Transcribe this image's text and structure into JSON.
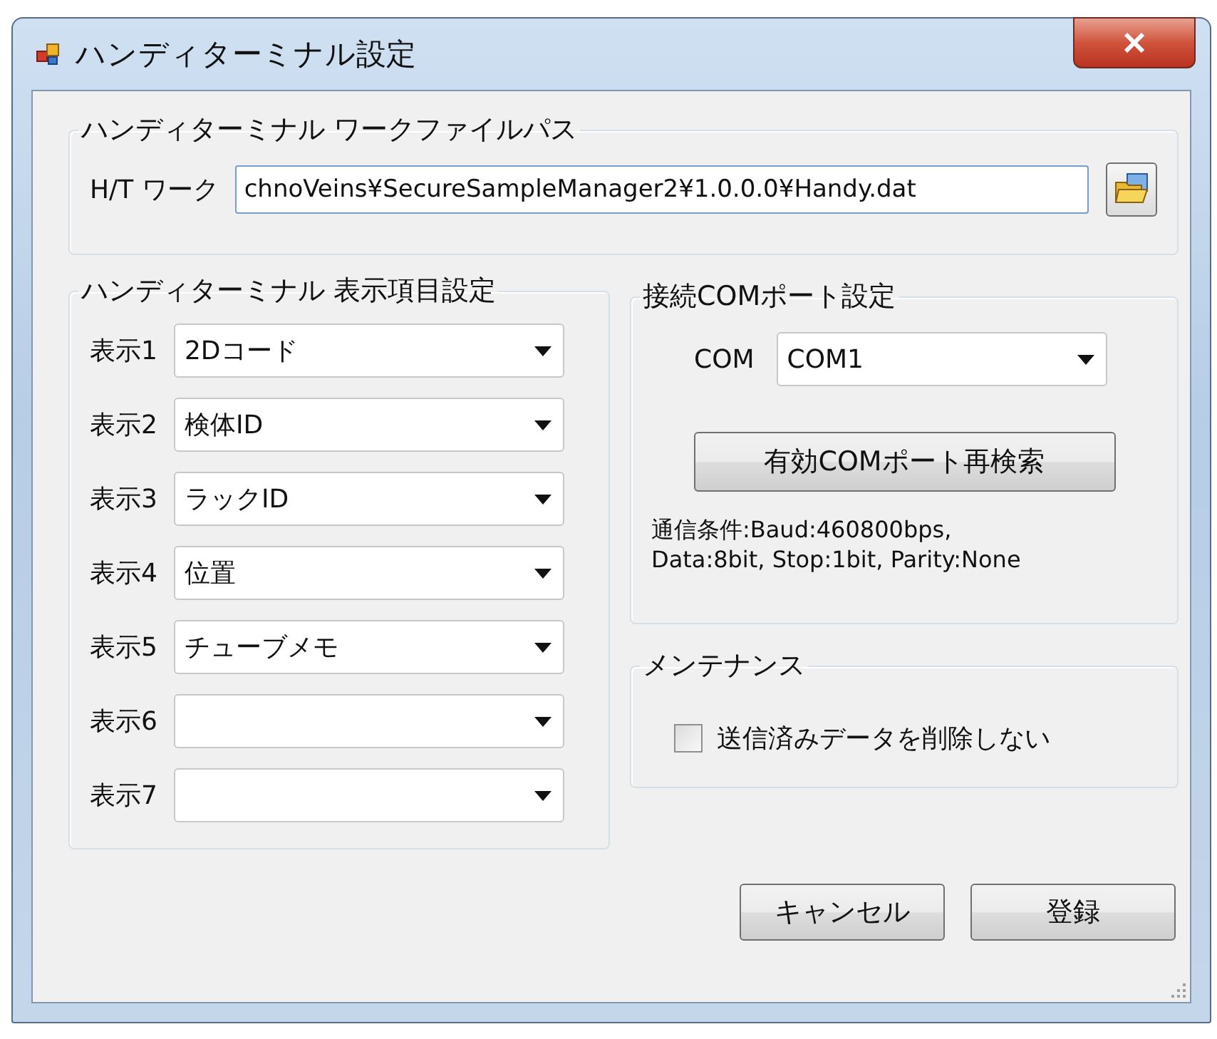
{
  "window": {
    "title": "ハンディターミナル設定"
  },
  "work_file_group": {
    "title": "ハンディターミナル  ワークファイルパス",
    "label": "H/T ワーク",
    "value": "chnoVeins¥SecureSampleManager2¥1.0.0.0¥Handy.dat"
  },
  "display_group": {
    "title": "ハンディターミナル 表示項目設定",
    "items": [
      {
        "label": "表示1",
        "value": "2Dコード"
      },
      {
        "label": "表示2",
        "value": "検体ID"
      },
      {
        "label": "表示3",
        "value": "ラックID"
      },
      {
        "label": "表示4",
        "value": "位置"
      },
      {
        "label": "表示5",
        "value": "チューブメモ"
      },
      {
        "label": "表示6"
      },
      {
        "label": "表示7"
      }
    ]
  },
  "com_group": {
    "title": "接続COMポート設定",
    "label": "COM",
    "value": "COM1",
    "rescan_button": "有効COMポート再検索",
    "conditions": [
      "通信条件:Baud:460800bps,",
      "Data:8bit, Stop:1bit, Parity:None"
    ]
  },
  "maintenance_group": {
    "title": "メンテナンス",
    "checkbox": {
      "label": "送信済みデータを削除しない",
      "checked": false
    }
  },
  "buttons": [
    {
      "label": "キャンセル"
    },
    {
      "label": "登録"
    }
  ]
}
